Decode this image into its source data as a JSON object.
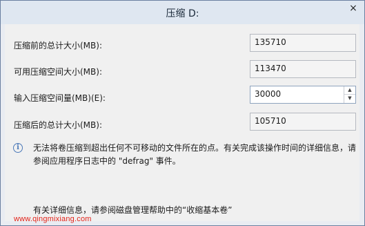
{
  "window": {
    "title": "压缩 D:",
    "close_label": "×"
  },
  "fields": {
    "total_before_label": "压缩前的总计大小(MB):",
    "total_before_value": "135710",
    "available_label": "可用压缩空间大小(MB):",
    "available_value": "113470",
    "input_label": "输入压缩空间量(MB)(E):",
    "input_value": "30000",
    "total_after_label": "压缩后的总计大小(MB):",
    "total_after_value": "105710"
  },
  "info": {
    "icon": "info-icon",
    "text": "无法将卷压缩到超出任何不可移动的文件所在的点。有关完成该操作时间的详细信息，请参阅应用程序日志中的 \"defrag\" 事件。"
  },
  "help": {
    "text": "有关详细信息，请参阅磁盘管理帮助中的“收缩基本卷”"
  },
  "watermark": {
    "text": "www.qingmixiang.com"
  }
}
